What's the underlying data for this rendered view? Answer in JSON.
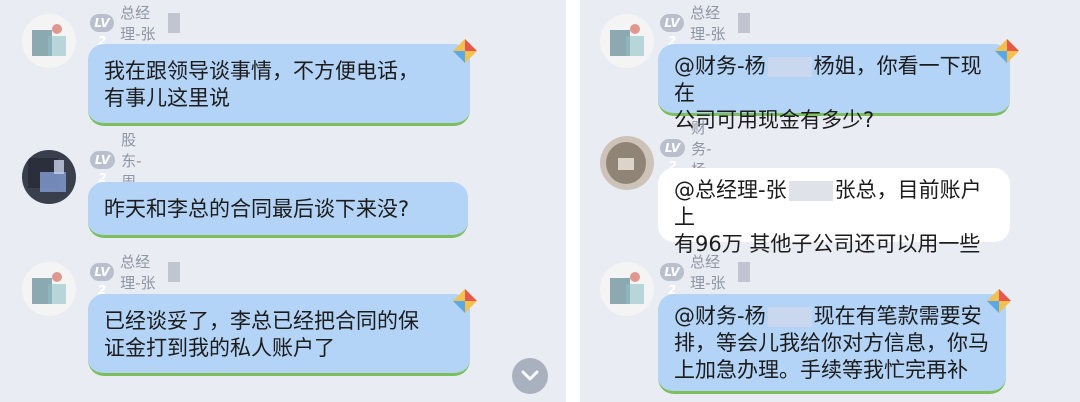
{
  "left_panel": {
    "messages": [
      {
        "level": "LV 2",
        "name": "总经理-张",
        "line1": "我在跟领导谈事情，不方便电话，",
        "line2": "有事儿这里说"
      },
      {
        "level": "LV 2",
        "name": "股东-周",
        "line1": "昨天和李总的合同最后谈下来没?",
        "line2": ""
      },
      {
        "level": "LV 2",
        "name": "总经理-张",
        "line1": "已经谈妥了，李总已经把合同的保",
        "line2": "证金打到我的私人账户了"
      }
    ],
    "scroll_down_icon": "chevron-down-icon"
  },
  "right_panel": {
    "messages": [
      {
        "level": "LV 2",
        "name": "总经理-张",
        "line1_a": "@财务-杨",
        "line1_b": "杨姐，你看一下现在",
        "line2": "公司可用现金有多少?",
        "line3": ""
      },
      {
        "level": "LV 2",
        "name": "财务-杨",
        "line1_a": "@总经理-张",
        "line1_b": "张总，目前账户上",
        "line2": "有96万 其他子公司还可以用一些",
        "line3": ""
      },
      {
        "level": "LV 2",
        "name": "总经理-张",
        "line1_a": "@财务-杨",
        "line1_b": "现在有笔款需要安",
        "line2": "排，等会儿我给你对方信息，你马",
        "line3": "上加急办理。手续等我忙完再补"
      }
    ]
  },
  "colors": {
    "background": "#e9ecf2",
    "bubble_blue": "#b3d3f7",
    "bubble_white": "#ffffff",
    "level_badge": "#b9bfcc",
    "name_text": "#8e95a3"
  }
}
